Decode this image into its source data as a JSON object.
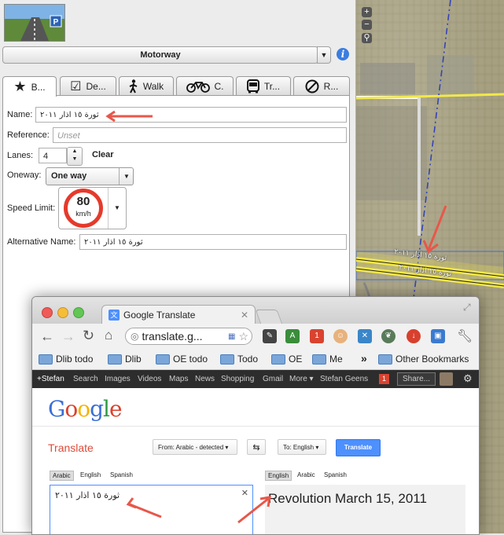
{
  "editor": {
    "preset_name": "Motorway",
    "tabs": [
      {
        "label": "B...",
        "icon": "star-icon"
      },
      {
        "label": "De...",
        "icon": "checkbox-icon"
      },
      {
        "label": "Walk",
        "icon": "pedestrian-icon"
      },
      {
        "label": "C.",
        "icon": "bicycle-icon"
      },
      {
        "label": "Tr...",
        "icon": "bus-icon"
      },
      {
        "label": "R...",
        "icon": "no-entry-icon"
      }
    ],
    "fields": {
      "name_label": "Name:",
      "name_value": "ثورة ١٥ اذار ٢٠١١",
      "reference_label": "Reference:",
      "reference_placeholder": "Unset",
      "lanes_label": "Lanes:",
      "lanes_value": "4",
      "clear_label": "Clear",
      "oneway_label": "Oneway:",
      "oneway_value": "One way",
      "speed_label": "Speed Limit:",
      "speed_value": "80",
      "speed_unit": "km/h",
      "altname_label": "Alternative Name:",
      "altname_value": "ثورة ١٥ اذار ٢٠١١"
    }
  },
  "map": {
    "road_label_1": "ثورة ١٥ اذار ٢٠١١",
    "road_label_2": "ثورة ١٥ اذار ٢٠١١"
  },
  "browser": {
    "tab_title": "Google Translate",
    "url": "translate.g...",
    "bookmarks": [
      "Dlib todo",
      "Dlib",
      "OE todo",
      "Todo",
      "OE",
      "Me"
    ],
    "other_bookmarks": "Other Bookmarks",
    "more_chevron": "»",
    "google_bar": {
      "links": [
        "+Stefan",
        "Search",
        "Images",
        "Videos",
        "Maps",
        "News",
        "Shopping",
        "Gmail",
        "More ▾"
      ],
      "user": "Stefan Geens",
      "notif_count": "1",
      "share": "Share..."
    },
    "ext_badge": "1"
  },
  "translate": {
    "logo": "Google",
    "product": "Translate",
    "from_label": "From: Arabic - detected",
    "to_label": "To: English",
    "translate_button": "Translate",
    "source_tabs": [
      "Arabic",
      "English",
      "Spanish"
    ],
    "target_tabs": [
      "English",
      "Arabic",
      "Spanish"
    ],
    "source_text": "ثورة ١٥ اذار ٢٠١١",
    "result_text": "Revolution March 15, 2011"
  },
  "colors": {
    "road_yellow": "#f2e84a",
    "translate_red": "#dd4b39",
    "translate_blue": "#4d90fe",
    "arrow_red": "#e8574a"
  }
}
